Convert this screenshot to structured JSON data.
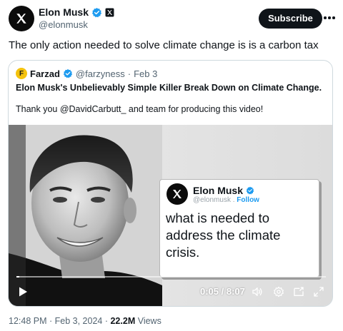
{
  "author": {
    "display_name": "Elon Musk",
    "handle": "@elonmusk",
    "avatar_icon": "x-logo-icon",
    "badges": [
      "verified-icon",
      "x-affiliate-icon"
    ]
  },
  "actions": {
    "subscribe_label": "Subscribe",
    "more_icon": "more-dots-icon"
  },
  "tweet": {
    "text": "The only action needed to solve climate change is is a carbon tax"
  },
  "quote": {
    "avatar_letter": "F",
    "display_name": "Farzad",
    "handle": "@farzyness",
    "separator": "·",
    "date": "Feb 3",
    "title": "Elon Musk's Unbelievably Simple Killer Break Down on Climate Change.",
    "body": "Thank you @DavidCarbutt_ and team for producing this video!"
  },
  "video": {
    "inner_card": {
      "display_name": "Elon Musk",
      "handle": "@elonmusk",
      "follow_label": "Follow",
      "text": "what is needed to address the climate crisis."
    },
    "time": "0:05 / 8:07",
    "progress_fraction": 0.01,
    "controls": [
      "play-icon",
      "volume-icon",
      "settings-icon",
      "pip-icon",
      "fullscreen-icon"
    ]
  },
  "footer": {
    "time": "12:48 PM",
    "date": "Feb 3, 2024",
    "views_count": "22.2M",
    "views_label": "Views"
  },
  "colors": {
    "text": "#0f1419",
    "muted": "#536471",
    "accent": "#1d9bf0",
    "border": "#cfd9de"
  }
}
